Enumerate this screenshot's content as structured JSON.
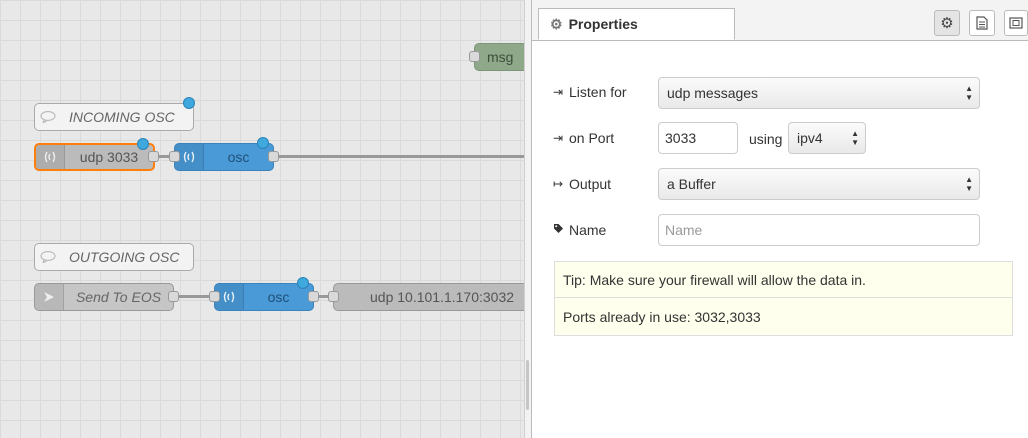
{
  "workspace": {
    "nodes": {
      "msg_label": "msg",
      "comment_incoming": "INCOMING OSC",
      "udp_in": "udp 3033",
      "osc_in": "osc",
      "comment_outgoing": "OUTGOING OSC",
      "send_to_eos": "Send To EOS",
      "osc_out": "osc",
      "udp_out": "udp 10.101.1.170:3032"
    }
  },
  "sidebar": {
    "tab_title": "Properties",
    "tab_icon": "gear-icon",
    "toolbar_icons": [
      "gear-icon",
      "document-icon",
      "frame-icon"
    ]
  },
  "form": {
    "listen_label": "Listen for",
    "listen_value": "udp messages",
    "port_label": "on Port",
    "port_value": "3033",
    "using_label": "using",
    "ipver_value": "ipv4",
    "output_label": "Output",
    "output_value": "a Buffer",
    "name_label": "Name",
    "name_value": "",
    "name_placeholder": "Name",
    "tip_text": "Tip: Make sure your firewall will allow the data in.",
    "ports_text": "Ports already in use: 3032,3033"
  },
  "colors": {
    "osc_node": "#4a9ad8",
    "udp_node": "#bbbbbb",
    "msg_node": "#8fa88a",
    "selected_border": "#ff7f0e",
    "changed_badge": "#3fa9dd",
    "tip_background": "#ffffee"
  }
}
